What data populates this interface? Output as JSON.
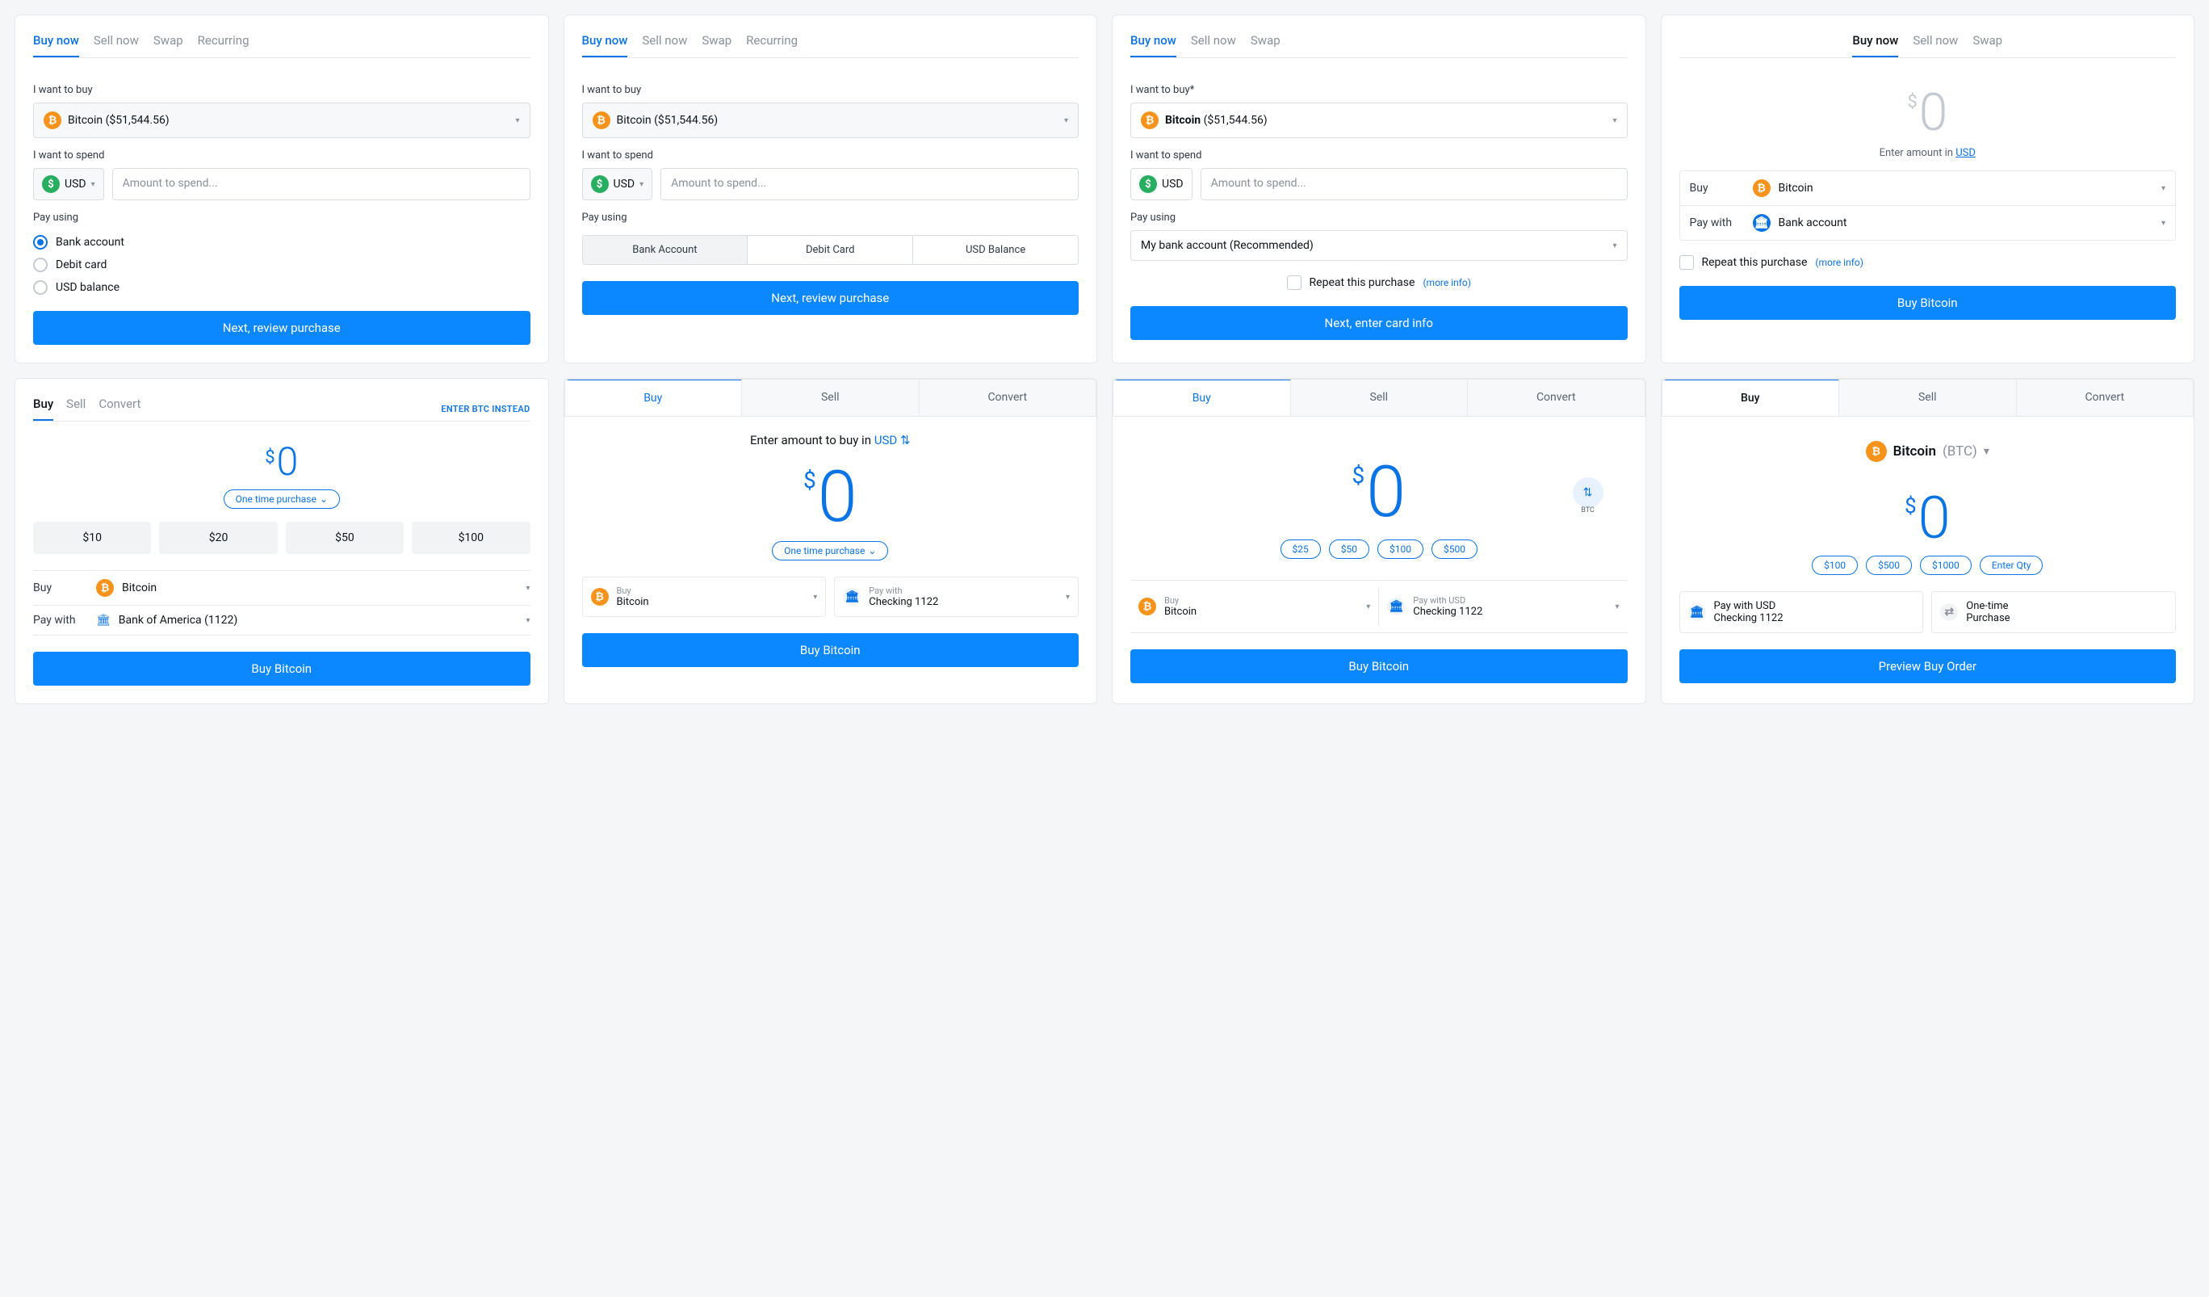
{
  "c1": {
    "tabs": [
      "Buy now",
      "Sell now",
      "Swap",
      "Recurring"
    ],
    "lbl_buy": "I want to buy",
    "asset": "Bitcoin ($51,544.56)",
    "lbl_spend": "I want to spend",
    "currency": "USD",
    "placeholder": "Amount to spend...",
    "lbl_pay": "Pay using",
    "radios": [
      "Bank account",
      "Debit card",
      "USD balance"
    ],
    "cta": "Next, review purchase"
  },
  "c2": {
    "tabs": [
      "Buy now",
      "Sell now",
      "Swap",
      "Recurring"
    ],
    "lbl_buy": "I want to buy",
    "asset": "Bitcoin ($51,544.56)",
    "lbl_spend": "I want to spend",
    "currency": "USD",
    "placeholder": "Amount to spend...",
    "lbl_pay": "Pay using",
    "segs": [
      "Bank Account",
      "Debit Card",
      "USD Balance"
    ],
    "cta": "Next, review purchase"
  },
  "c3": {
    "tabs": [
      "Buy now",
      "Sell now",
      "Swap"
    ],
    "lbl_buy": "I want to buy*",
    "asset_name": "Bitcoin",
    "asset_price": "($51,544.56)",
    "lbl_spend": "I want to spend",
    "currency": "USD",
    "placeholder": "Amount to spend...",
    "lbl_pay": "Pay using",
    "pay_method": "My bank account (Recommended)",
    "repeat": "Repeat this purchase",
    "more": "(more info)",
    "cta": "Next, enter card info"
  },
  "c4": {
    "tabs": [
      "Buy now",
      "Sell now",
      "Swap"
    ],
    "amount_prefix": "$",
    "amount": "0",
    "hint_pre": "Enter amount in ",
    "hint_link": "USD",
    "buy_lbl": "Buy",
    "buy_val": "Bitcoin",
    "pay_lbl": "Pay with",
    "pay_val": "Bank account",
    "repeat": "Repeat this purchase",
    "more": "(more info)",
    "cta": "Buy Bitcoin"
  },
  "c5": {
    "tabs": [
      "Buy",
      "Sell",
      "Convert"
    ],
    "link": "ENTER BTC INSTEAD",
    "amount_prefix": "$",
    "amount": "0",
    "pill": "One time purchase",
    "chips": [
      "$10",
      "$20",
      "$50",
      "$100"
    ],
    "buy_lbl": "Buy",
    "buy_val": "Bitcoin",
    "pay_lbl": "Pay with",
    "pay_val": "Bank of America (1122)",
    "cta": "Buy Bitcoin"
  },
  "c6": {
    "tabs": [
      "Buy",
      "Sell",
      "Convert"
    ],
    "hint_pre": "Enter amount to buy in ",
    "hint_link": "USD",
    "amount_prefix": "$",
    "amount": "0",
    "pill": "One time purchase",
    "buy_mini": "Buy",
    "buy_val": "Bitcoin",
    "pay_mini": "Pay with",
    "pay_val": "Checking 1122",
    "cta": "Buy Bitcoin"
  },
  "c7": {
    "tabs": [
      "Buy",
      "Sell",
      "Convert"
    ],
    "amount_prefix": "$",
    "amount": "0",
    "swap_lbl": "BTC",
    "pills": [
      "$25",
      "$50",
      "$100",
      "$500"
    ],
    "buy_mini": "Buy",
    "buy_val": "Bitcoin",
    "pay_mini": "Pay with USD",
    "pay_val": "Checking 1122",
    "cta": "Buy Bitcoin"
  },
  "c8": {
    "tabs": [
      "Buy",
      "Sell",
      "Convert"
    ],
    "asset_name": "Bitcoin",
    "asset_sym": "(BTC)",
    "amount_prefix": "$",
    "amount": "0",
    "pills": [
      "$100",
      "$500",
      "$1000",
      "Enter Qty"
    ],
    "pay_mini": "Pay with USD",
    "pay_val": "Checking 1122",
    "freq_mini": "One-time",
    "freq_val": "Purchase",
    "cta": "Preview Buy Order"
  }
}
